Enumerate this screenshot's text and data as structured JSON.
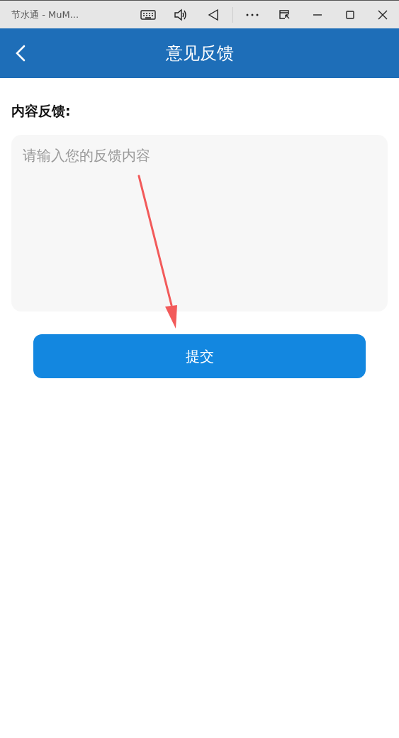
{
  "window": {
    "title": "节水通 - MuM..."
  },
  "header": {
    "title": "意见反馈"
  },
  "form": {
    "label": "内容反馈:",
    "placeholder": "请输入您的反馈内容"
  },
  "buttons": [
    "提交"
  ]
}
